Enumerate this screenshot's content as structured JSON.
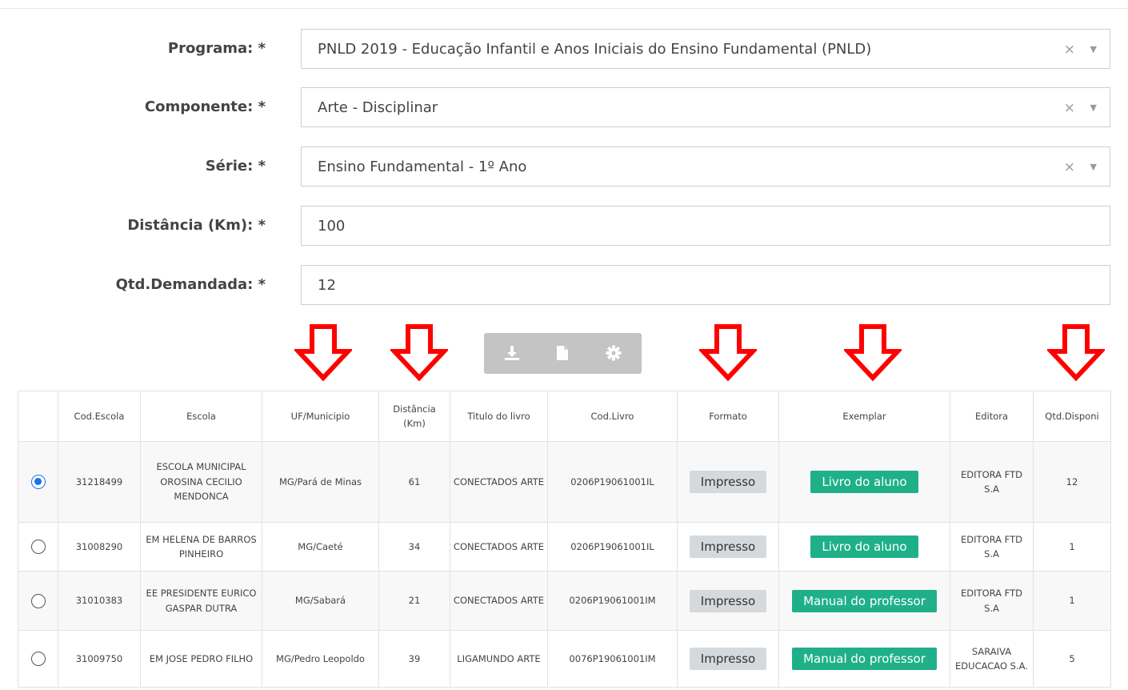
{
  "form": {
    "programa": {
      "label": "Programa: *",
      "value": "PNLD 2019 - Educação Infantil e Anos Iniciais do Ensino Fundamental (PNLD)"
    },
    "componente": {
      "label": "Componente: *",
      "value": "Arte - Disciplinar"
    },
    "serie": {
      "label": "Série: *",
      "value": "Ensino Fundamental - 1º Ano"
    },
    "distancia": {
      "label": "Distância (Km): *",
      "value": "100"
    },
    "qtd": {
      "label": "Qtd.Demandada: *",
      "value": "12"
    },
    "clear_glyph": "×",
    "caret_glyph": "▼"
  },
  "toolbar": {
    "icons": [
      "download-icon",
      "file-icon",
      "gear-icon"
    ]
  },
  "colors": {
    "arrow": "#ff0000",
    "badge_green": "#1fb08a",
    "badge_gray": "#d6d9dc",
    "radio": "#1a73e8"
  },
  "table": {
    "headers": [
      "",
      "Cod.Escola",
      "Escola",
      "UF/Municipio",
      "Distância (Km)",
      "Titulo do livro",
      "Cod.Livro",
      "Formato",
      "Exemplar",
      "Editora",
      "Qtd.Disponi"
    ],
    "rows": [
      {
        "selected": true,
        "cod_escola": "31218499",
        "escola": "ESCOLA MUNICIPAL OROSINA CECILIO MENDONCA",
        "uf_municipio": "MG/Pará de Minas",
        "distancia": "61",
        "titulo": "CONECTADOS ARTE",
        "cod_livro": "0206P19061001IL",
        "formato": "Impresso",
        "exemplar": "Livro do aluno",
        "editora": "EDITORA FTD S.A",
        "qtd": "12"
      },
      {
        "selected": false,
        "cod_escola": "31008290",
        "escola": "EM HELENA DE BARROS PINHEIRO",
        "uf_municipio": "MG/Caeté",
        "distancia": "34",
        "titulo": "CONECTADOS ARTE",
        "cod_livro": "0206P19061001IL",
        "formato": "Impresso",
        "exemplar": "Livro do aluno",
        "editora": "EDITORA FTD S.A",
        "qtd": "1"
      },
      {
        "selected": false,
        "cod_escola": "31010383",
        "escola": "EE PRESIDENTE EURICO GASPAR DUTRA",
        "uf_municipio": "MG/Sabará",
        "distancia": "21",
        "titulo": "CONECTADOS ARTE",
        "cod_livro": "0206P19061001IM",
        "formato": "Impresso",
        "exemplar": "Manual do professor",
        "editora": "EDITORA FTD S.A",
        "qtd": "1"
      },
      {
        "selected": false,
        "cod_escola": "31009750",
        "escola": "EM JOSE PEDRO FILHO",
        "uf_municipio": "MG/Pedro Leopoldo",
        "distancia": "39",
        "titulo": "LIGAMUNDO ARTE",
        "cod_livro": "0076P19061001IM",
        "formato": "Impresso",
        "exemplar": "Manual do professor",
        "editora": "SARAIVA EDUCACAO S.A.",
        "qtd": "5"
      }
    ]
  }
}
